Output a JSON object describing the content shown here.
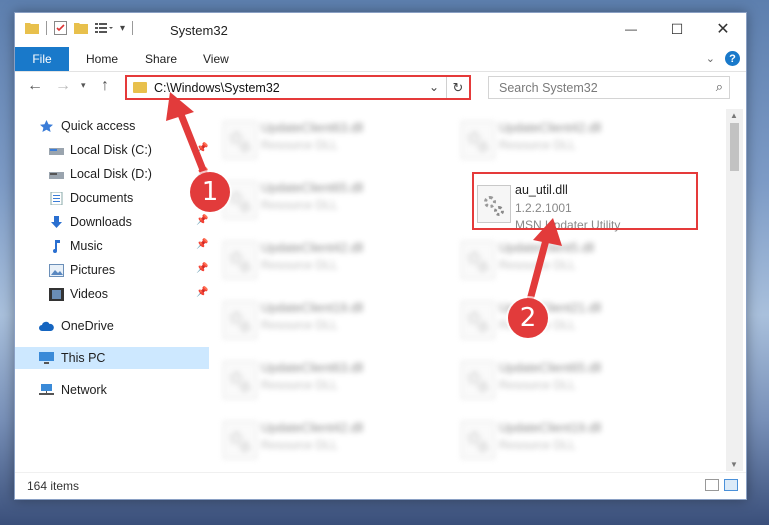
{
  "window": {
    "title": "System32",
    "minimize": "—",
    "maximize": "☐",
    "close": "✕"
  },
  "ribbon": {
    "tabs": [
      "File",
      "Home",
      "Share",
      "View"
    ]
  },
  "address": {
    "path": "C:\\Windows\\System32",
    "search_placeholder": "Search System32"
  },
  "sidebar": {
    "items": [
      {
        "label": "Quick access",
        "icon": "star-icon"
      },
      {
        "label": "Local Disk (C:)",
        "icon": "drive-icon"
      },
      {
        "label": "Local Disk (D:)",
        "icon": "drive-icon"
      },
      {
        "label": "Documents",
        "icon": "documents-icon"
      },
      {
        "label": "Downloads",
        "icon": "download-icon"
      },
      {
        "label": "Music",
        "icon": "music-icon"
      },
      {
        "label": "Pictures",
        "icon": "pictures-icon"
      },
      {
        "label": "Videos",
        "icon": "videos-icon"
      },
      {
        "label": "OneDrive",
        "icon": "cloud-icon"
      },
      {
        "label": "This PC",
        "icon": "computer-icon"
      },
      {
        "label": "Network",
        "icon": "network-icon"
      }
    ]
  },
  "files": {
    "left": [
      {
        "name": "UpdateClient63.dll",
        "desc": "Resource DLL"
      },
      {
        "name": "UpdateClient65.dll",
        "desc": "Resource DLL"
      },
      {
        "name": "UpdateClient42.dll",
        "desc": "Resource DLL"
      },
      {
        "name": "UpdateClient19.dll",
        "desc": "Resource DLL"
      },
      {
        "name": "UpdateClient63.dll",
        "desc": "Resource DLL"
      },
      {
        "name": "UpdateClient42.dll",
        "desc": "Resource DLL"
      }
    ],
    "right": [
      {
        "name": "UpdateClient42.dll",
        "desc": "Resource DLL"
      },
      {
        "name": "UpdateClient5.dll",
        "desc": "Resource DLL"
      },
      {
        "name": "UpdateClient21.dll",
        "desc": "Resource DLL"
      },
      {
        "name": "UpdateClient65.dll",
        "desc": "Resource DLL"
      },
      {
        "name": "UpdateClient19.dll",
        "desc": "Resource DLL"
      }
    ],
    "highlighted": {
      "name": "au_util.dll",
      "version": "1.2.2.1001",
      "desc": "MSN Updater Utility"
    }
  },
  "status": {
    "count": "164 items"
  },
  "annotations": {
    "step1": "1",
    "step2": "2",
    "color": "#e23b3b"
  }
}
